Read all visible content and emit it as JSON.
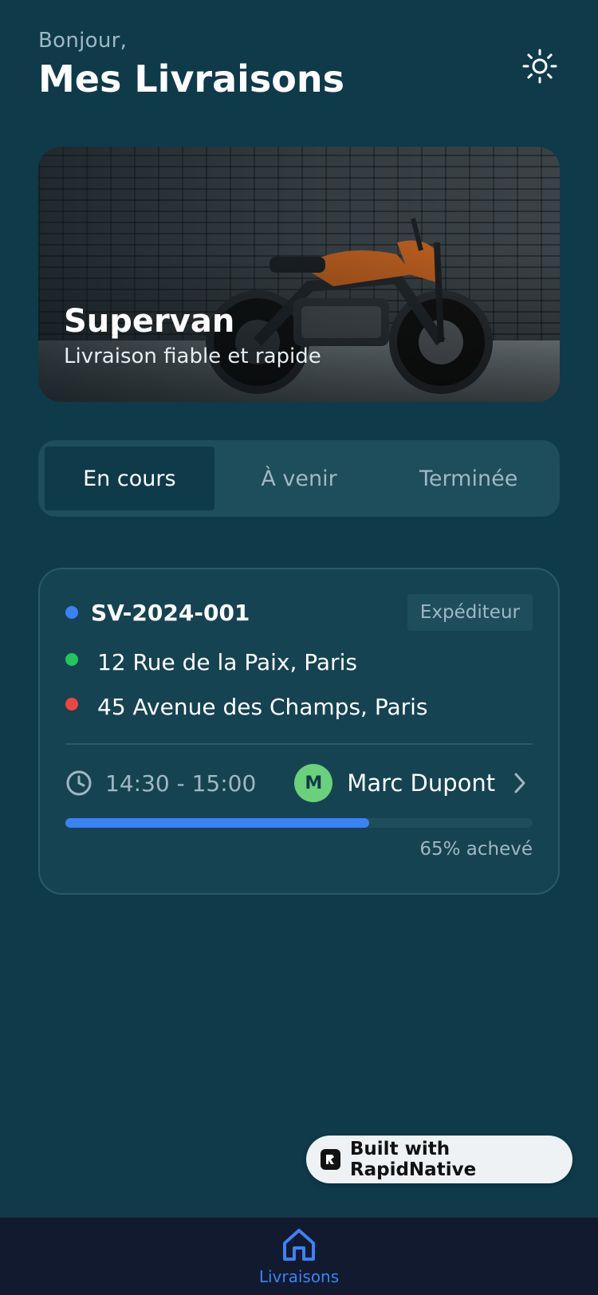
{
  "header": {
    "greeting": "Bonjour,",
    "title": "Mes Livraisons",
    "theme_icon": "sun-icon"
  },
  "hero": {
    "title": "Supervan",
    "subtitle": "Livraison fiable et rapide"
  },
  "tabs": [
    {
      "label": "En cours",
      "active": true
    },
    {
      "label": "À venir",
      "active": false
    },
    {
      "label": "Terminée",
      "active": false
    }
  ],
  "delivery": {
    "id": "SV-2024-001",
    "role": "Expéditeur",
    "pickup": "12 Rue de la Paix, Paris",
    "dropoff": "45 Avenue des Champs, Paris",
    "time": "14:30 - 15:00",
    "driver_initial": "M",
    "driver_name": "Marc Dupont",
    "progress": 0.65,
    "progress_label": "65% achevé"
  },
  "badge": {
    "text": "Built with RapidNative"
  },
  "nav": {
    "items": [
      {
        "label": "Livraisons",
        "icon": "home-icon",
        "active": true
      }
    ]
  },
  "colors": {
    "background": "#0f3a4a",
    "accent": "#3b82f6",
    "pickup": "#22c55e",
    "dropoff": "#ef4444",
    "avatar": "#6ad07b"
  }
}
